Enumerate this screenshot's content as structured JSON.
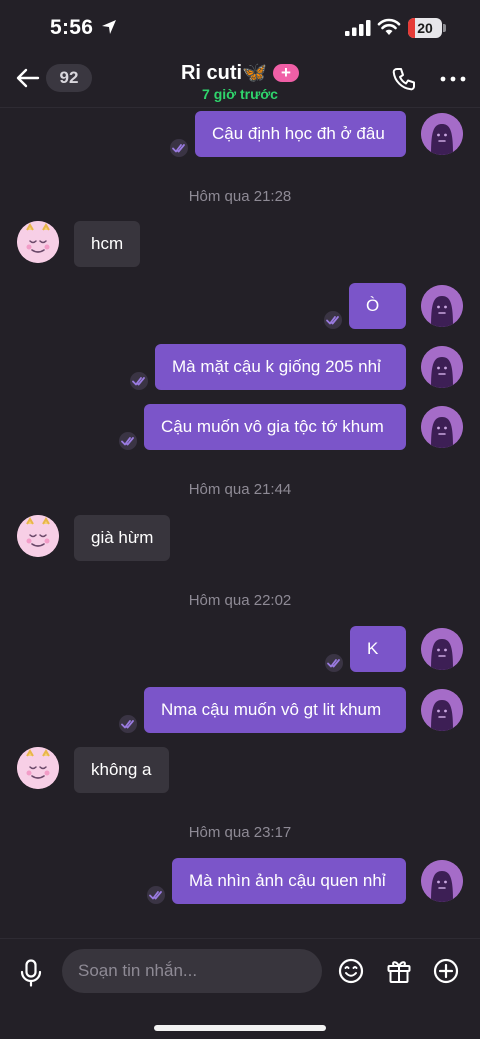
{
  "status_bar": {
    "time": "5:56",
    "battery_level": "20",
    "battery_fraction": 0.2,
    "icons": [
      "location-arrow-icon",
      "signal-icon",
      "wifi-icon",
      "battery-icon"
    ]
  },
  "header": {
    "back_icon": "arrow-left-icon",
    "unread_count": "92",
    "contact_name": "Ri cuti🦋",
    "plus_badge": "+",
    "last_seen": "7 giờ trước",
    "call_icon": "phone-icon",
    "more_icon": "more-dots-icon"
  },
  "messages": [
    {
      "type": "sent",
      "text": "Cậu định học đh ở đâu"
    },
    {
      "type": "timestamp",
      "text": "Hôm qua 21:28"
    },
    {
      "type": "received",
      "text": "hcm"
    },
    {
      "type": "sent",
      "text": "Ò"
    },
    {
      "type": "sent",
      "text": "Mà mặt cậu k giống 205 nhỉ"
    },
    {
      "type": "sent",
      "text": "Cậu muốn vô gia tộc tớ khum"
    },
    {
      "type": "timestamp",
      "text": "Hôm qua 21:44"
    },
    {
      "type": "received",
      "text": "già hừm"
    },
    {
      "type": "timestamp",
      "text": "Hôm qua 22:02"
    },
    {
      "type": "sent",
      "text": "K"
    },
    {
      "type": "sent",
      "text": "Nma cậu muốn vô gt lit khum"
    },
    {
      "type": "received",
      "text": "không a"
    },
    {
      "type": "timestamp",
      "text": "Hôm qua 23:17"
    },
    {
      "type": "sent",
      "text": "Mà nhìn ảnh cậu quen nhỉ"
    }
  ],
  "composer": {
    "placeholder": "Soạn tin nhắn...",
    "icons": [
      "microphone-icon",
      "emoji-icon",
      "gift-icon",
      "add-circle-icon"
    ]
  },
  "colors": {
    "background": "#232027",
    "sent_bubble": "#7b55c9",
    "received_bubble": "#38353d",
    "online_green": "#2fd46c",
    "plus_pink": "#f05fa6"
  }
}
